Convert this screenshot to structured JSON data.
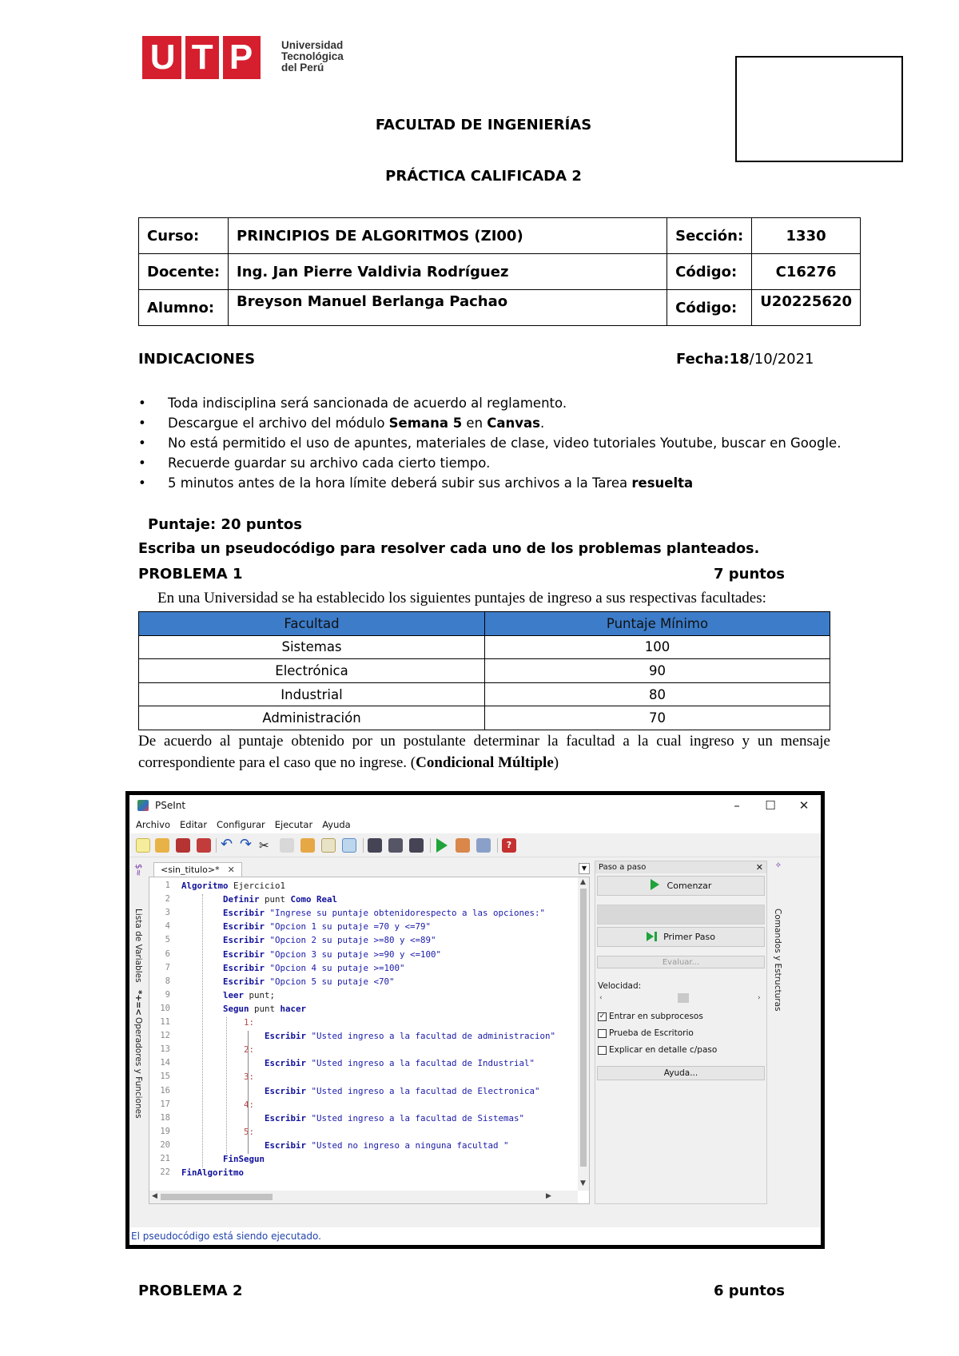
{
  "header": {
    "logo_letters": [
      "U",
      "T",
      "P"
    ],
    "logo_lines": [
      "Universidad",
      "Tecnológica",
      "del Perú"
    ],
    "faculty": "FACULTAD DE INGENIERÍAS",
    "exam_title": "PRÁCTICA CALIFICADA 2"
  },
  "info": {
    "curso_label": "Curso:",
    "curso_value": "PRINCIPIOS DE ALGORITMOS (ZI00)",
    "seccion_label": "Sección:",
    "seccion_value": "1330",
    "docente_label": "Docente:",
    "docente_value": "Ing. Jan Pierre Valdivia Rodríguez",
    "codigo_label": "Código:",
    "codigo_docente": "C16276",
    "alumno_label": "Alumno:",
    "alumno_value": "Breyson Manuel Berlanga Pachao",
    "codigo_alumno": "U20225620"
  },
  "indicaciones": {
    "heading": "INDICACIONES",
    "fecha_label": "Fecha:",
    "fecha_day": "18",
    "fecha_rest": "/10/2021",
    "items": [
      {
        "pre": "Toda indisciplina será sancionada de acuerdo al reglamento.",
        "b1": "",
        "mid": "",
        "b2": "",
        "post": ""
      },
      {
        "pre": "Descargue el archivo del módulo ",
        "b1": "Semana 5",
        "mid": " en ",
        "b2": "Canvas",
        "post": "."
      },
      {
        "pre": "No está permitido el uso de apuntes, materiales de clase, video tutoriales Youtube, buscar en Google.",
        "b1": "",
        "mid": "",
        "b2": "",
        "post": ""
      },
      {
        "pre": "Recuerde guardar su archivo cada cierto tiempo.",
        "b1": "",
        "mid": "",
        "b2": "",
        "post": ""
      },
      {
        "pre": "5 minutos antes de la hora límite deberá subir sus archivos a la Tarea ",
        "b1": "resuelta",
        "mid": "",
        "b2": "",
        "post": ""
      }
    ]
  },
  "puntaje": "Puntaje: 20 puntos",
  "instruction": "Escriba un pseudocódigo para resolver cada uno de los problemas planteados.",
  "problema1": {
    "title": "PROBLEMA 1",
    "points": "7 puntos",
    "intro": "En una Universidad se ha establecido los siguientes puntajes de ingreso a sus respectivas facultades:",
    "table": {
      "headers": [
        "Facultad",
        "Puntaje Mínimo"
      ],
      "rows": [
        [
          "Sistemas",
          "100"
        ],
        [
          "Electrónica",
          "90"
        ],
        [
          "Industrial",
          "80"
        ],
        [
          "Administración",
          "70"
        ]
      ]
    },
    "description": "De acuerdo al puntaje obtenido por un postulante determinar la facultad a la cual ingreso y un mensaje correspondiente para el caso que no ingrese. (",
    "description_bold": "Condicional Múltiple",
    "description_end": ")"
  },
  "pseint": {
    "title": "PSeInt",
    "menu": [
      "Archivo",
      "Editar",
      "Configurar",
      "Ejecutar",
      "Ayuda"
    ],
    "tab": "<sin_titulo>*",
    "left_side_1": "Lista de Variables",
    "left_side_2": "Operadores y Funciones",
    "right_side": "Comandos y Estructuras",
    "code_lines": [
      [
        {
          "t": "Algoritmo",
          "c": "kw"
        },
        {
          "t": " Ejercicio1",
          "c": ""
        }
      ],
      [
        {
          "t": "        ",
          "c": ""
        },
        {
          "t": "Definir",
          "c": "kw"
        },
        {
          "t": " punt ",
          "c": ""
        },
        {
          "t": "Como Real",
          "c": "kw"
        }
      ],
      [
        {
          "t": "        ",
          "c": ""
        },
        {
          "t": "Escribir",
          "c": "kw"
        },
        {
          "t": " \"Ingrese su puntaje obtenidorespecto a las opciones:\"",
          "c": "str"
        }
      ],
      [
        {
          "t": "        ",
          "c": ""
        },
        {
          "t": "Escribir",
          "c": "kw"
        },
        {
          "t": " \"Opcion 1 su putaje =70 y <=79\"",
          "c": "str"
        }
      ],
      [
        {
          "t": "        ",
          "c": ""
        },
        {
          "t": "Escribir",
          "c": "kw"
        },
        {
          "t": " \"Opcion 2 su putaje >=80 y <=89\"",
          "c": "str"
        }
      ],
      [
        {
          "t": "        ",
          "c": ""
        },
        {
          "t": "Escribir",
          "c": "kw"
        },
        {
          "t": " \"Opcion 3 su putaje >=90 y <=100\"",
          "c": "str"
        }
      ],
      [
        {
          "t": "        ",
          "c": ""
        },
        {
          "t": "Escribir",
          "c": "kw"
        },
        {
          "t": " \"Opcion 4 su putaje >=100\"",
          "c": "str"
        }
      ],
      [
        {
          "t": "        ",
          "c": ""
        },
        {
          "t": "Escribir",
          "c": "kw"
        },
        {
          "t": " \"Opcion 5 su putaje <70\"",
          "c": "str"
        }
      ],
      [
        {
          "t": "        ",
          "c": ""
        },
        {
          "t": "leer",
          "c": "kw"
        },
        {
          "t": " punt;",
          "c": ""
        }
      ],
      [
        {
          "t": "        ",
          "c": ""
        },
        {
          "t": "Segun",
          "c": "kw"
        },
        {
          "t": " punt ",
          "c": ""
        },
        {
          "t": "hacer",
          "c": "kw"
        }
      ],
      [
        {
          "t": "            ",
          "c": ""
        },
        {
          "t": "1:",
          "c": "cs"
        }
      ],
      [
        {
          "t": "                ",
          "c": ""
        },
        {
          "t": "Escribir",
          "c": "kw"
        },
        {
          "t": " \"Usted ingreso a la facultad de administracion\"",
          "c": "str"
        }
      ],
      [
        {
          "t": "            ",
          "c": ""
        },
        {
          "t": "2:",
          "c": "cs"
        }
      ],
      [
        {
          "t": "                ",
          "c": ""
        },
        {
          "t": "Escribir",
          "c": "kw"
        },
        {
          "t": " \"Usted ingreso a la facultad de Industrial\"",
          "c": "str"
        }
      ],
      [
        {
          "t": "            ",
          "c": ""
        },
        {
          "t": "3:",
          "c": "cs"
        }
      ],
      [
        {
          "t": "                ",
          "c": ""
        },
        {
          "t": "Escribir",
          "c": "kw"
        },
        {
          "t": " \"Usted ingreso a la facultad de Electronica\"",
          "c": "str"
        }
      ],
      [
        {
          "t": "            ",
          "c": ""
        },
        {
          "t": "4:",
          "c": "cs"
        }
      ],
      [
        {
          "t": "                ",
          "c": ""
        },
        {
          "t": "Escribir",
          "c": "kw"
        },
        {
          "t": " \"Usted ingreso a la facultad de Sistemas\"",
          "c": "str"
        }
      ],
      [
        {
          "t": "            ",
          "c": ""
        },
        {
          "t": "5:",
          "c": "cs"
        }
      ],
      [
        {
          "t": "                ",
          "c": ""
        },
        {
          "t": "Escribir",
          "c": "kw"
        },
        {
          "t": " \"Usted no ingreso a ninguna facultad \"",
          "c": "str"
        }
      ],
      [
        {
          "t": "        ",
          "c": ""
        },
        {
          "t": "FinSegun",
          "c": "kw"
        }
      ],
      [
        {
          "t": "FinAlgoritmo",
          "c": "kw"
        }
      ]
    ],
    "panel": {
      "title": "Paso a paso",
      "comenzar": "Comenzar",
      "primer_paso": "Primer Paso",
      "evaluar": "Evaluar...",
      "velocidad": "Velocidad:",
      "checks": [
        {
          "label": "Entrar en subprocesos",
          "checked": true
        },
        {
          "label": "Prueba de Escritorio",
          "checked": false
        },
        {
          "label": "Explicar en detalle c/paso",
          "checked": false
        }
      ],
      "ayuda": "Ayuda..."
    },
    "status": "El pseudocódigo está siendo ejecutado."
  },
  "problema2": {
    "title": "PROBLEMA 2",
    "points": "6 puntos"
  }
}
